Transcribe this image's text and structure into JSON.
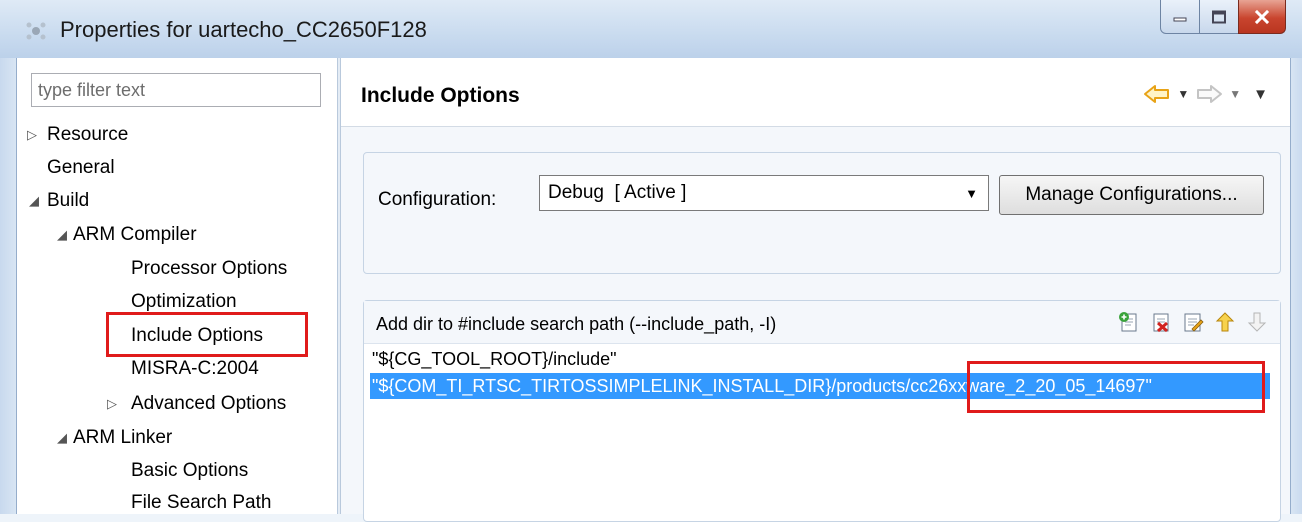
{
  "window": {
    "title": "Properties for uartecho_CC2650F128"
  },
  "filter": {
    "placeholder": "type filter text"
  },
  "tree": [
    {
      "label": "Resource",
      "arrow": "▷"
    },
    {
      "label": "General",
      "arrow": ""
    },
    {
      "label": "Build",
      "arrow": "◢"
    },
    {
      "label": "ARM Compiler",
      "arrow": "◢"
    },
    {
      "label": "Processor Options",
      "arrow": ""
    },
    {
      "label": "Optimization",
      "arrow": ""
    },
    {
      "label": "Include Options",
      "arrow": "",
      "selected": true
    },
    {
      "label": "MISRA-C:2004",
      "arrow": ""
    },
    {
      "label": "Advanced Options",
      "arrow": "▷"
    },
    {
      "label": "ARM Linker",
      "arrow": "◢"
    },
    {
      "label": "Basic Options",
      "arrow": ""
    },
    {
      "label": "File Search Path",
      "arrow": ""
    }
  ],
  "page": {
    "title": "Include Options"
  },
  "configuration": {
    "label": "Configuration:",
    "value": "Debug  [ Active ]",
    "manage_button": "Manage Configurations..."
  },
  "include": {
    "label": "Add dir to #include search path (--include_path, -I)",
    "paths": [
      "\"${CG_TOOL_ROOT}/include\"",
      "\"${COM_TI_RTSC_TIRTOSSIMPLELINK_INSTALL_DIR}/products/cc26xxware_2_20_05_14697\""
    ]
  },
  "colors": {
    "highlight": "#e01b1b",
    "selection": "#3399ff",
    "nav_arrow": "#e8a317"
  },
  "icons": [
    "program-icon",
    "minimize-icon",
    "maximize-icon",
    "close-icon",
    "back-arrow-icon",
    "forward-arrow-icon",
    "add-path-icon",
    "delete-path-icon",
    "edit-path-icon",
    "move-up-icon",
    "move-down-icon"
  ]
}
